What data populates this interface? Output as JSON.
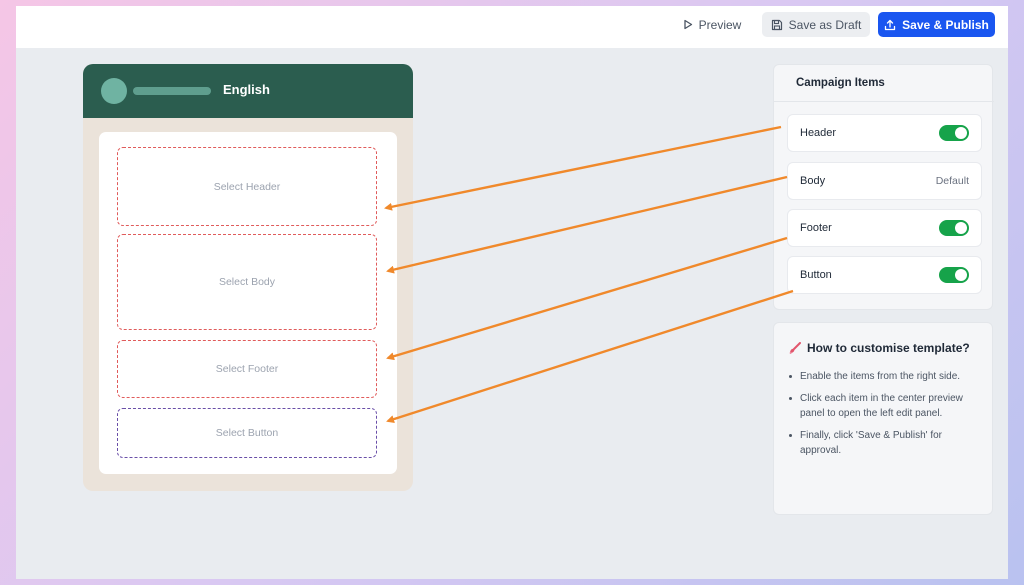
{
  "toolbar": {
    "preview_label": "Preview",
    "draft_label": "Save as Draft",
    "publish_label": "Save & Publish",
    "preview_icon": "play-outline-icon",
    "draft_icon": "floppy-disk-icon",
    "publish_icon": "upload-icon"
  },
  "preview": {
    "language": "English",
    "slots": {
      "header": "Select Header",
      "body": "Select Body",
      "footer": "Select Footer",
      "button": "Select Button"
    }
  },
  "campaign_items": {
    "title": "Campaign Items",
    "items": [
      {
        "label": "Header",
        "state": "on"
      },
      {
        "label": "Body",
        "value": "Default"
      },
      {
        "label": "Footer",
        "state": "on"
      },
      {
        "label": "Button",
        "state": "on"
      }
    ]
  },
  "help": {
    "icon": "brush-icon",
    "title": "How to customise template?",
    "steps": [
      "Enable the items from the right side.",
      "Click each item in the center preview panel to open the left edit panel.",
      "Finally, click 'Save & Publish' for approval."
    ]
  },
  "colors": {
    "accent": "#1a56f0",
    "phone_header": "#2b5d4f",
    "toggle_on": "#16a34a",
    "arrow": "#f0892b",
    "slot_border": "#e05b5b",
    "button_slot_border": "#6a4fa8"
  }
}
